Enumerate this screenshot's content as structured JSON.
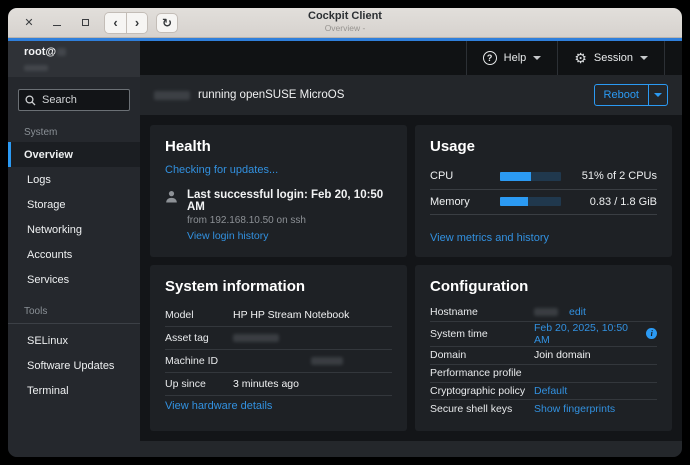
{
  "window": {
    "title": "Cockpit Client",
    "subtitle": "Overview -"
  },
  "masthead": {
    "help_label": "Help",
    "session_label": "Session"
  },
  "sidebar": {
    "user": "root@",
    "search_placeholder": "Search",
    "sections": [
      {
        "label": "System",
        "items": [
          "Overview",
          "Logs",
          "Storage",
          "Networking",
          "Accounts",
          "Services"
        ],
        "active_item": "Overview"
      },
      {
        "label": "Tools",
        "items": [
          "SELinux",
          "Software Updates",
          "Terminal"
        ]
      }
    ]
  },
  "content_header": {
    "status_text": "running openSUSE MicroOS",
    "reboot_label": "Reboot"
  },
  "cards": {
    "health": {
      "title": "Health",
      "updates_link": "Checking for updates...",
      "login_heading": "Last successful login: Feb 20, 10:50 AM",
      "login_detail": "from 192.168.10.50 on ssh",
      "login_link": "View login history"
    },
    "usage": {
      "title": "Usage",
      "rows": [
        {
          "label": "CPU",
          "percent": 51,
          "value": "51% of 2 CPUs"
        },
        {
          "label": "Memory",
          "percent": 46,
          "value": "0.83 / 1.8 GiB"
        }
      ],
      "link": "View metrics and history"
    },
    "system_info": {
      "title": "System information",
      "rows": [
        {
          "label": "Model",
          "value": "HP HP Stream Notebook"
        },
        {
          "label": "Asset tag",
          "value": ""
        },
        {
          "label": "Machine ID",
          "value": ""
        },
        {
          "label": "Up since",
          "value": "3 minutes ago"
        }
      ],
      "link": "View hardware details"
    },
    "configuration": {
      "title": "Configuration",
      "rows": [
        {
          "label": "Hostname",
          "value": "edit"
        },
        {
          "label": "System time",
          "value": "Feb 20, 2025, 10:50 AM"
        },
        {
          "label": "Domain",
          "value": "Join domain"
        },
        {
          "label": "Performance profile",
          "value": ""
        },
        {
          "label": "Cryptographic policy",
          "value": "Default"
        },
        {
          "label": "Secure shell keys",
          "value": "Show fingerprints"
        }
      ]
    }
  },
  "colors": {
    "accent_blue": "#2b9af3",
    "link_blue": "#3291e0",
    "titlebar_accent": "#2f7fdb",
    "card_bg": "#1e2125",
    "sidebar_bg": "#25282d"
  }
}
